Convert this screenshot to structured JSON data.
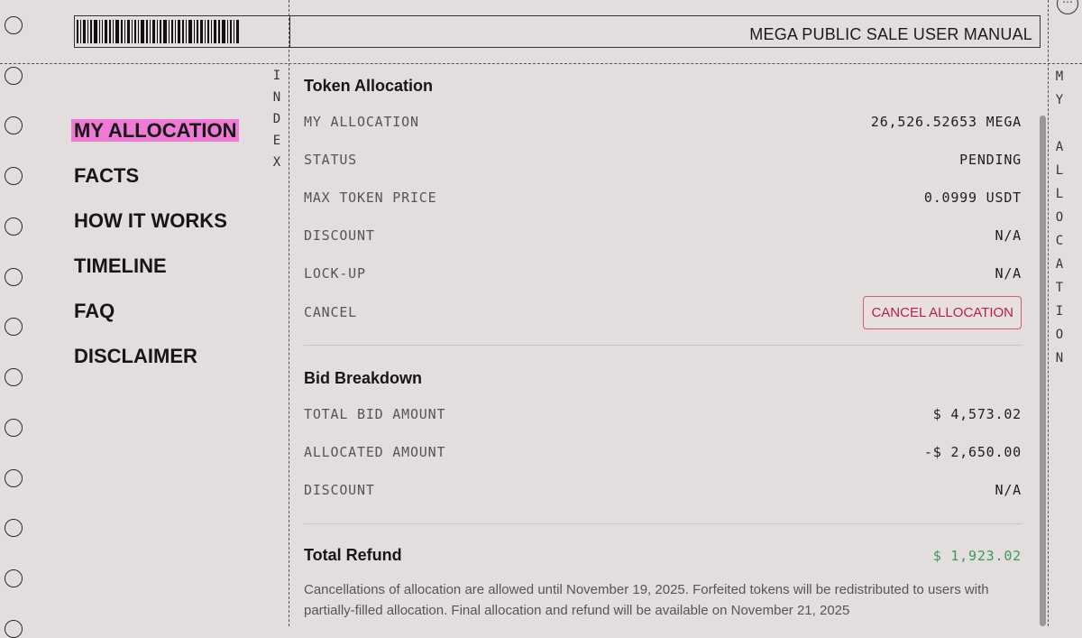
{
  "header": {
    "title": "MEGA PUBLIC SALE USER MANUAL"
  },
  "index_label": "INDEX",
  "side_label": "MY ALLOCATION",
  "nav": {
    "items": [
      {
        "label": "MY ALLOCATION",
        "active": true
      },
      {
        "label": "FACTS"
      },
      {
        "label": "HOW IT WORKS"
      },
      {
        "label": "TIMELINE"
      },
      {
        "label": "FAQ"
      },
      {
        "label": "DISCLAIMER"
      }
    ]
  },
  "token_allocation": {
    "title": "Token Allocation",
    "my_allocation": {
      "label": "MY ALLOCATION",
      "value": "26,526.52653 MEGA"
    },
    "status": {
      "label": "STATUS",
      "value": "PENDING",
      "color": "#a87a2a"
    },
    "max_token_price": {
      "label": "MAX TOKEN PRICE",
      "value": "0.0999 USDT"
    },
    "discount": {
      "label": "DISCOUNT",
      "value": "N/A"
    },
    "lockup": {
      "label": "LOCK-UP",
      "value": "N/A"
    },
    "cancel": {
      "label": "CANCEL",
      "button": "CANCEL ALLOCATION"
    }
  },
  "bid_breakdown": {
    "title": "Bid Breakdown",
    "total_bid": {
      "label": "TOTAL BID AMOUNT",
      "value": "$ 4,573.02"
    },
    "allocated": {
      "label": "ALLOCATED AMOUNT",
      "value": "-$ 2,650.00"
    },
    "discount": {
      "label": "DISCOUNT",
      "value": "N/A"
    }
  },
  "total_refund": {
    "title": "Total Refund",
    "value": "$ 1,923.02",
    "color": "#3a9a5a"
  },
  "note": "Cancellations of allocation are allowed until November 19, 2025. Forfeited tokens will be redistributed to users with partially-filled allocation. Final allocation and refund will be available on November 21, 2025"
}
